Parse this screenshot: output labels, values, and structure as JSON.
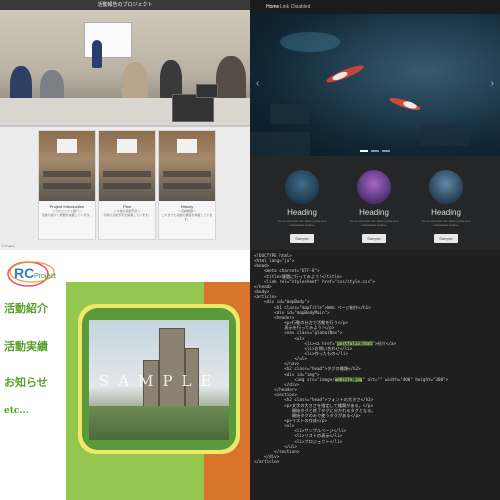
{
  "q1": {
    "title": "活動報告のプロジェクト",
    "cards": [
      {
        "title": "Project Introduction",
        "subtitle": "～プロジェクト紹介～",
        "desc": "活動の紹介と概要を掲載しています。"
      },
      {
        "title": "Plan",
        "subtitle": "～今後の活動予定～",
        "desc": "今後の活動予定を掲載しています。"
      },
      {
        "title": "History",
        "subtitle": "～活動履歴～",
        "desc": "これまでの活動の履歴を掲載しています。"
      }
    ],
    "footer": "© Project"
  },
  "q2": {
    "nav": {
      "brand": "Home",
      "items": [
        "Link",
        "Disabled"
      ]
    },
    "columns": [
      {
        "heading": "Heading",
        "text": "Donec sed odio dui. Etiam porta sem malesuada magna.",
        "button": "Sample"
      },
      {
        "heading": "Heading",
        "text": "Donec sed odio dui. Etiam porta sem malesuada magna.",
        "button": "Sample"
      },
      {
        "heading": "Heading",
        "text": "Donec sed odio dui. Etiam porta sem malesuada magna.",
        "button": "Sample"
      }
    ],
    "arrows": {
      "prev": "‹",
      "next": "›"
    }
  },
  "q3": {
    "logo_text": "Project",
    "logo_letters": "RC",
    "menu": [
      "活動紹介",
      "活動実績",
      "お知らせ",
      "etc..."
    ],
    "watermark": "SAMPLE"
  },
  "q4": {
    "code_lines": [
      "<!DOCTYPE html>",
      "<html lang=\"ja\">",
      "<head>",
      "    <meta charset=\"UTF-8\">",
      "    <title>課題に行ってみよう!</title>",
      "    <link rel=\"stylesheet\" href=\"css/style.css\">",
      "</head>",
      "<body>",
      "<article>",
      "    <div id=\"mapBody\">",
      "        <h1 class=\"mapTitle\">Web ページ制作</h1>",
      "        <div id=\"mapBodyMain\">",
      "        <header>",
      "            <p>行動の仕方で活動を行う</p>",
      "            表示を行ってみよう!</p>",
      "            <nav class=\"globalNav\">",
      "                <ul>",
      "                    <li><a href=\"portfolio.html\">紹介</a>",
      "                    <li>お問い合わせ</li>",
      "                    <li>作ったもの</li>",
      "                </ul>",
      "            </nav>",
      "            <h2 class=\"head\">タグの種類</h2>",
      "            <div id=\"img\">",
      "                <img src=\"image/website.jpg\" alt=\"\" width=\"400\" height=\"300\">",
      "            </div>",
      "        </header>",
      "        <section>",
      "            <h2 class=\"head\">フォントの大きさ</h2>",
      "            <p>文字の大きさを指定して種類がある。</p>",
      "               開始タグと終了タグに分かれるタグとなる。",
      "               開始タグのみで使うタグがある</p>",
      "            <p>リストの作成</p>",
      "            <ul>",
      "                <li>サンプルページ</li>",
      "                <li>リストの表示</li>",
      "                <li>プロジェクト</li>",
      "            </ul>",
      "        </section>",
      "    </div>",
      "</article>"
    ]
  }
}
